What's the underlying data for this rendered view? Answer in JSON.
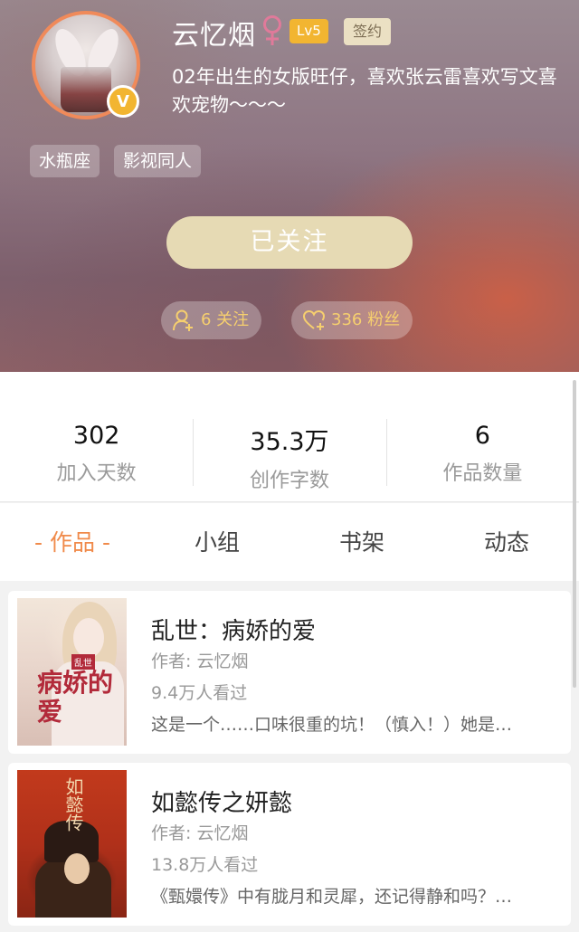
{
  "profile": {
    "name": "云忆烟",
    "level": "Lv5",
    "sign_badge": "签约",
    "verified_badge": "V",
    "bio": "02年出生的女版旺仔，喜欢张云雷喜欢写文喜欢宠物～～～",
    "tags": [
      "水瓶座",
      "影视同人"
    ],
    "follow_button": "已关注",
    "following": "6 关注",
    "fans": "336 粉丝"
  },
  "stats": [
    {
      "value": "302",
      "label": "加入天数"
    },
    {
      "value": "35.3万",
      "label": "创作字数"
    },
    {
      "value": "6",
      "label": "作品数量"
    }
  ],
  "tabs": [
    "- 作品 -",
    "小组",
    "书架",
    "动态"
  ],
  "books": [
    {
      "title": "乱世：病娇的爱",
      "author": "作者: 云忆烟",
      "views": "9.4万人看过",
      "desc": "这是一个……口味很重的坑！（慎入！）她是…",
      "cover_title": "病娇的爱",
      "cover_small": "乱世"
    },
    {
      "title": "如懿传之妍懿",
      "author": "作者: 云忆烟",
      "views": "13.8万人看过",
      "desc": "《甄嬛传》中有胧月和灵犀，还记得静和吗？…",
      "cover_title": "如懿传"
    }
  ],
  "colors": {
    "accent": "#f08a4a",
    "level_badge": "#f2b531",
    "follow_button": "#e6dab4",
    "pill_text": "#f6cf6e"
  }
}
